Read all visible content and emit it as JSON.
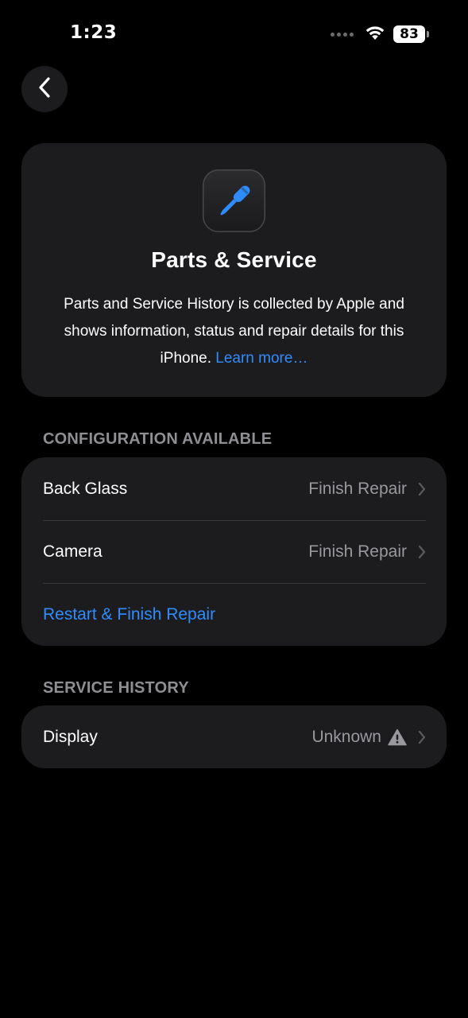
{
  "status_bar": {
    "time": "1:23",
    "battery": "83"
  },
  "header": {
    "title": "Parts & Service",
    "description": "Parts and Service History is collected by Apple and shows information, status and repair details for this iPhone. ",
    "learn_more": "Learn more…",
    "icon": "screwdriver-icon",
    "accent_color": "#2f8cff"
  },
  "configuration": {
    "header": "CONFIGURATION AVAILABLE",
    "rows": [
      {
        "label": "Back Glass",
        "value": "Finish Repair"
      },
      {
        "label": "Camera",
        "value": "Finish Repair"
      }
    ],
    "action": "Restart & Finish Repair"
  },
  "service_history": {
    "header": "SERVICE HISTORY",
    "rows": [
      {
        "label": "Display",
        "value": "Unknown",
        "icon": "warning-icon"
      }
    ]
  }
}
